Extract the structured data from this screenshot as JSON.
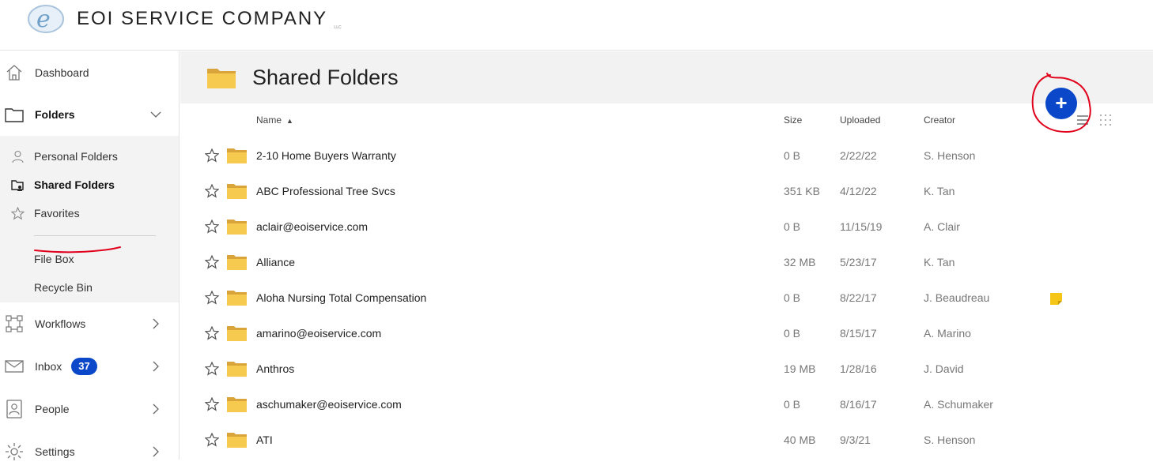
{
  "header": {
    "company_name": "EOI SERVICE COMPANY",
    "company_suffix": "LLC"
  },
  "sidebar": {
    "items": [
      {
        "label": "Dashboard",
        "icon": "home-icon"
      },
      {
        "label": "Folders",
        "icon": "folder-icon",
        "expanded": true
      },
      {
        "label": "Workflows",
        "icon": "workflow-icon"
      },
      {
        "label": "Inbox",
        "icon": "mail-icon",
        "badge": "37"
      },
      {
        "label": "People",
        "icon": "contact-icon"
      },
      {
        "label": "Settings",
        "icon": "gear-icon"
      }
    ],
    "folder_subitems": [
      {
        "label": "Personal Folders",
        "icon": "person-icon"
      },
      {
        "label": "Shared Folders",
        "icon": "shared-folder-icon",
        "active": true
      },
      {
        "label": "Favorites",
        "icon": "star-icon"
      },
      {
        "label": "File Box"
      },
      {
        "label": "Recycle Bin"
      }
    ]
  },
  "main": {
    "title": "Shared Folders",
    "columns": {
      "name": "Name",
      "size": "Size",
      "uploaded": "Uploaded",
      "creator": "Creator"
    },
    "add_button": "+",
    "rows": [
      {
        "name": "2-10 Home Buyers Warranty",
        "size": "0 B",
        "uploaded": "2/22/22",
        "creator": "S. Henson"
      },
      {
        "name": "ABC Professional Tree Svcs",
        "size": "351 KB",
        "uploaded": "4/12/22",
        "creator": "K. Tan"
      },
      {
        "name": "aclair@eoiservice.com",
        "size": "0 B",
        "uploaded": "11/15/19",
        "creator": "A. Clair"
      },
      {
        "name": "Alliance",
        "size": "32 MB",
        "uploaded": "5/23/17",
        "creator": "K. Tan"
      },
      {
        "name": "Aloha Nursing Total Compensation",
        "size": "0 B",
        "uploaded": "8/22/17",
        "creator": "J. Beaudreau",
        "has_note": true
      },
      {
        "name": "amarino@eoiservice.com",
        "size": "0 B",
        "uploaded": "8/15/17",
        "creator": "A. Marino"
      },
      {
        "name": "Anthros",
        "size": "19 MB",
        "uploaded": "1/28/16",
        "creator": "J. David"
      },
      {
        "name": "aschumaker@eoiservice.com",
        "size": "0 B",
        "uploaded": "8/16/17",
        "creator": "A. Schumaker"
      },
      {
        "name": "ATI",
        "size": "40 MB",
        "uploaded": "9/3/21",
        "creator": "S. Henson"
      }
    ]
  },
  "colors": {
    "accent": "#0b48c9",
    "folder": "#f3c24a",
    "annotation": "#e0001b",
    "note": "#f5c518"
  }
}
